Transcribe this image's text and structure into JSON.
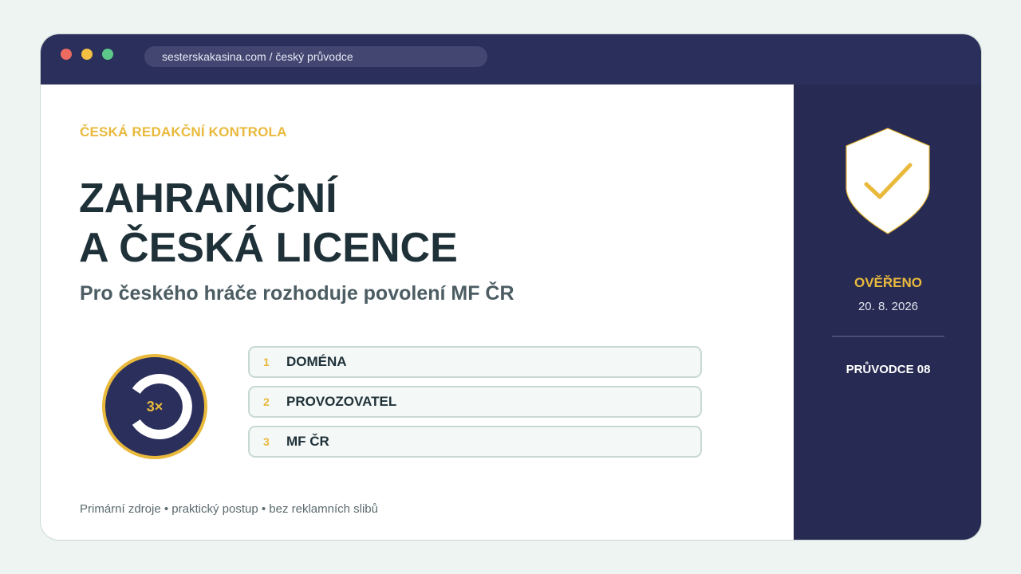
{
  "window": {
    "url": "sesterskakasina.com / český průvodce"
  },
  "main": {
    "eyebrow": "ČESKÁ REDAKČNÍ KONTROLA",
    "title_line1": "ZAHRANIČNÍ",
    "title_line2": "A ČESKÁ LICENCE",
    "subtitle": "Pro českého hráče rozhoduje povolení MF ČR",
    "badge": "3×",
    "steps": [
      {
        "num": "1",
        "label": "DOMÉNA"
      },
      {
        "num": "2",
        "label": "PROVOZOVATEL"
      },
      {
        "num": "3",
        "label": "MF ČR"
      }
    ],
    "footer": "Primární zdroje • praktický postup • bez reklamních slibů"
  },
  "side": {
    "status": "OVĚŘENO",
    "date": "20. 8. 2026",
    "guide": "PRŮVODCE 08",
    "icon": "shield-check-icon"
  },
  "colors": {
    "accent": "#e9b93c",
    "navy": "#2b2f5c",
    "text": "#1f3138"
  }
}
